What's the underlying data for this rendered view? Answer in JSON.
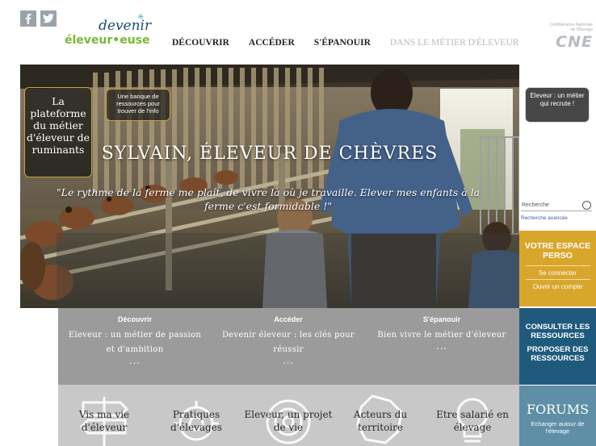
{
  "header": {
    "logo_top": "devenir",
    "logo_bottom": "éleveur•euse",
    "nav": [
      "DÉCOUVRIR",
      "ACCÉDER",
      "S'ÉPANOUIR",
      "DANS LE MÉTIER D'ÉLEVEUR"
    ],
    "cne_small": "Confédération Nationale de l'Élevage",
    "cne_big": "CNE"
  },
  "hero": {
    "title": "SYLVAIN, ÉLEVEUR DE CHÈVRES",
    "quote": "\"Le rythme de la ferme me plaît, de vivre là où je travaille. Elever mes enfants à la ferme c'est formidable !\"",
    "box_plateforme": "La plateforme du métier d'éleveur de ruminants",
    "box_banque": "Une banque de ressources pour trouver de l'info"
  },
  "sidebar": {
    "eleveur_box": "Eleveur : un métier qui recrute !",
    "search_placeholder": "Recherche",
    "search_advanced": "Recherche avancée",
    "espace_title": "VOTRE ESPACE PERSO",
    "espace_login": "Se connecter",
    "espace_register": "Ouvrir un compte",
    "consult": "CONSULTER LES RESSOURCES",
    "propose": "PROPOSER DES RESSOURCES",
    "forums_title": "FORUMS",
    "forums_sub": "Echanger autour de l'élevage"
  },
  "categories": [
    {
      "heading": "Découvrir",
      "desc": "Eleveur : un métier de passion et d'ambition",
      "more": "..."
    },
    {
      "heading": "Accéder",
      "desc": "Devenir éleveur : les clés pour réussir",
      "more": "..."
    },
    {
      "heading": "S'épanouir",
      "desc": "Bien vivre le métier d'éleveur",
      "more": "..."
    }
  ],
  "themes": [
    {
      "label": "Vis ma vie d'éleveur",
      "icon": "signpost-icon"
    },
    {
      "label": "Pratiques d'élevages",
      "icon": "gear-icon"
    },
    {
      "label": "Eleveur, un projet de vie",
      "icon": "target-icon"
    },
    {
      "label": "Acteurs du territoire",
      "icon": "map-icon"
    },
    {
      "label": "Etre salarié en élevage",
      "icon": "lightbulb-icon"
    }
  ],
  "colors": {
    "accent_gold": "#d9a62c",
    "accent_blue": "#1f5a7c",
    "forums_blue": "#5e8fa6",
    "logo_green": "#7ab733",
    "logo_navy": "#1c4d78"
  }
}
